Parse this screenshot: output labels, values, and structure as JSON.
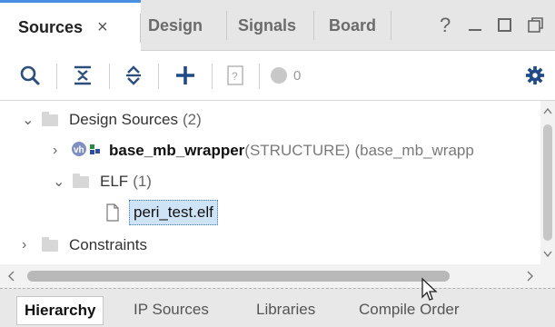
{
  "tabs": [
    {
      "label": "Sources",
      "active": true,
      "closable": true,
      "close_glyph": "×"
    },
    {
      "label": "Design"
    },
    {
      "label": "Signals"
    },
    {
      "label": "Board"
    }
  ],
  "window_controls": {
    "help": "?",
    "minimize": "—",
    "maximize": "☐",
    "restore": "⧉"
  },
  "toolbar": {
    "badge_count": "0"
  },
  "tree": {
    "design_sources": {
      "label": "Design Sources",
      "count": "(2)"
    },
    "wrapper": {
      "name": "base_mb_wrapper",
      "type": "(STRUCTURE)",
      "file": "(base_mb_wrapp"
    },
    "elf": {
      "label": "ELF",
      "count": "(1)"
    },
    "elf_file": {
      "label": "peri_test.elf"
    },
    "constraints": {
      "label": "Constraints"
    }
  },
  "bottom_tabs": [
    {
      "label": "Hierarchy",
      "active": true
    },
    {
      "label": "IP Sources"
    },
    {
      "label": "Libraries"
    },
    {
      "label": "Compile Order"
    }
  ],
  "colors": {
    "accent": "#4a90e2",
    "selection": "#cfe3f7",
    "tab_bg": "#e6e6e6"
  }
}
